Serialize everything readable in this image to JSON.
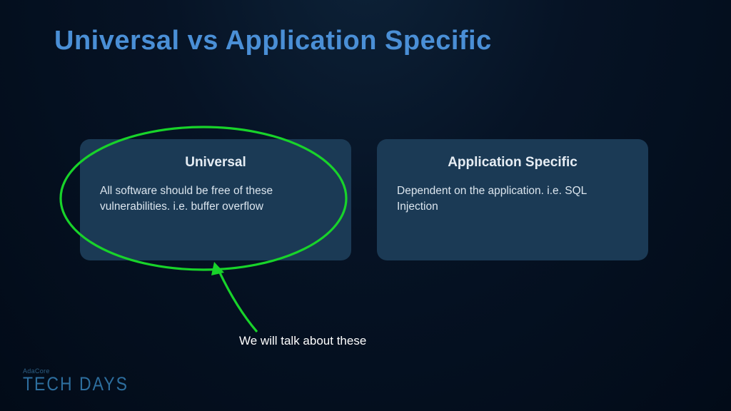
{
  "title": "Universal vs Application Specific",
  "cards": {
    "left": {
      "title": "Universal",
      "body": "All software should be free of these vulnerabilities. i.e. buffer overflow"
    },
    "right": {
      "title": "Application Specific",
      "body": "Dependent on the application. i.e. SQL Injection"
    }
  },
  "annotation": {
    "text": "We will talk about these",
    "color": "#18d32a"
  },
  "brand": {
    "small": "AdaCore",
    "big": "TECH DAYS"
  }
}
